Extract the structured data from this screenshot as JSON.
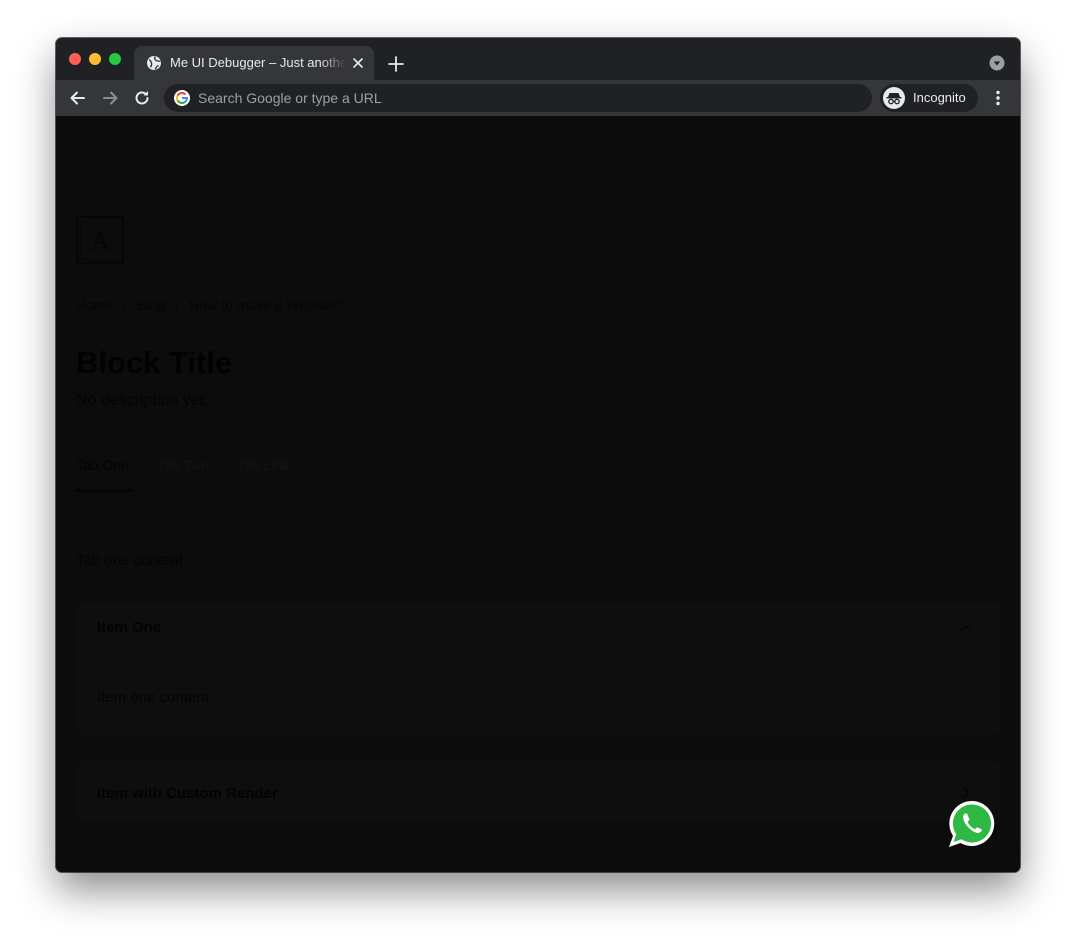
{
  "browser": {
    "tab": {
      "title": "Me UI Debugger – Just another",
      "favicon": "globe-icon"
    },
    "omnibox": {
      "placeholder": "Search Google or type a URL"
    },
    "profile": {
      "label": "Incognito"
    },
    "colors": {
      "traffic_red": "#ff5f57",
      "traffic_yellow": "#febc2e",
      "traffic_green": "#28c840",
      "tabstrip": "#202124",
      "toolbar": "#35363a"
    }
  },
  "page": {
    "logo_letter": "A",
    "breadcrumb": {
      "items": [
        "Home",
        "Blog",
        "How to make a Website?"
      ],
      "separator": "/"
    },
    "title": "Block Title",
    "description": "No description yet.",
    "tabs": [
      {
        "label": "Tab One",
        "active": true
      },
      {
        "label": "Tab Two",
        "active": false
      },
      {
        "label": "Tab Link",
        "active": false
      }
    ],
    "tab_content": "Tab one content.",
    "accordion": [
      {
        "title": "Item One",
        "content": "Item one content.",
        "expanded": true
      },
      {
        "title": "Item with Custom Render",
        "expanded": false
      }
    ],
    "floating_button": "whatsapp-icon"
  }
}
